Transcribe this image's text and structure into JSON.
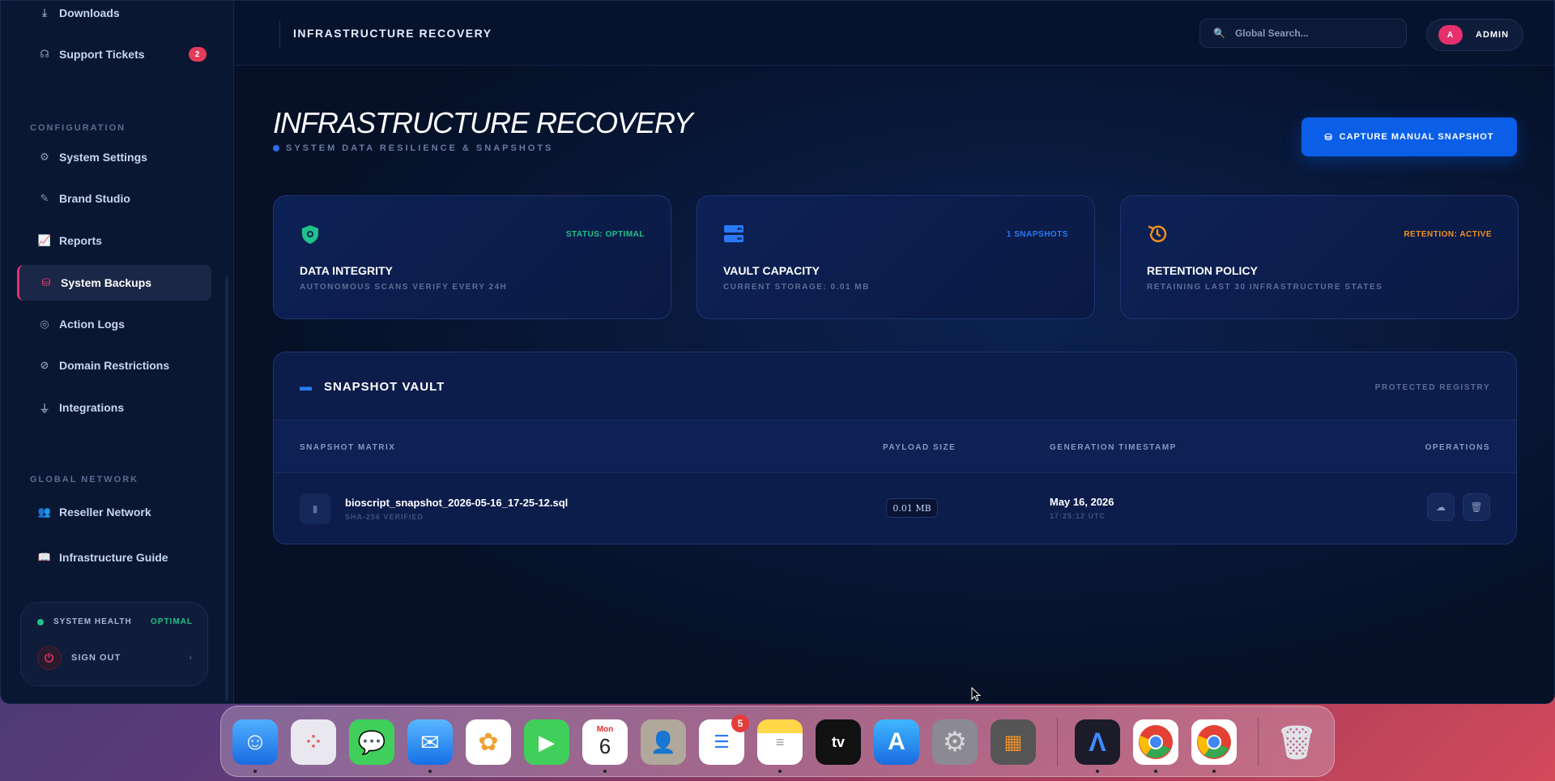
{
  "sidebar": {
    "items_top": [
      {
        "label": "Downloads",
        "icon": "download-icon"
      },
      {
        "label": "Support Tickets",
        "icon": "headset-icon",
        "badge": "2"
      }
    ],
    "config_label": "CONFIGURATION",
    "config_items": [
      {
        "label": "System Settings",
        "icon": "gear-icon"
      },
      {
        "label": "Brand Studio",
        "icon": "brush-icon"
      },
      {
        "label": "Reports",
        "icon": "chart-line-icon"
      },
      {
        "label": "System Backups",
        "icon": "database-icon",
        "active": true
      },
      {
        "label": "Action Logs",
        "icon": "fingerprint-icon"
      },
      {
        "label": "Domain Restrictions",
        "icon": "ban-icon"
      },
      {
        "label": "Integrations",
        "icon": "plug-icon"
      }
    ],
    "network_label": "GLOBAL NETWORK",
    "network_items": [
      {
        "label": "Reseller Network",
        "icon": "users-icon"
      },
      {
        "label": "Infrastructure Guide",
        "icon": "book-icon"
      }
    ],
    "health": {
      "label": "SYSTEM HEALTH",
      "status": "OPTIMAL"
    },
    "signout": "SIGN OUT"
  },
  "topbar": {
    "title": "INFRASTRUCTURE RECOVERY",
    "search_placeholder": "Global Search...",
    "user_initial": "A",
    "user_label": "ADMIN"
  },
  "page": {
    "title": "INFRASTRUCTURE RECOVERY",
    "subtitle": "SYSTEM DATA RESILIENCE & SNAPSHOTS",
    "capture_button": "CAPTURE MANUAL SNAPSHOT"
  },
  "cards": [
    {
      "tag": "STATUS: OPTIMAL",
      "title": "DATA INTEGRITY",
      "sub": "AUTONOMOUS SCANS VERIFY EVERY 24H",
      "color": "#1fc28a",
      "icon": "shield-virus-icon"
    },
    {
      "tag": "1 SNAPSHOTS",
      "title": "VAULT CAPACITY",
      "sub": "CURRENT STORAGE: 0.01 MB",
      "color": "#2a7af5",
      "icon": "server-icon"
    },
    {
      "tag": "RETENTION: ACTIVE",
      "title": "RETENTION POLICY",
      "sub": "RETAINING LAST 30 INFRASTRUCTURE STATES",
      "color": "#f0901e",
      "icon": "history-icon"
    }
  ],
  "vault": {
    "title": "SNAPSHOT VAULT",
    "registry": "PROTECTED REGISTRY",
    "columns": [
      "SNAPSHOT MATRIX",
      "PAYLOAD SIZE",
      "GENERATION TIMESTAMP",
      "OPERATIONS"
    ],
    "rows": [
      {
        "file": "bioscript_snapshot_2026-05-16_17-25-12.sql",
        "hash": "SHA-256 VERIFIED",
        "size": "0.01 MB",
        "date": "May 16, 2026",
        "time": "17:25:12 UTC"
      }
    ]
  },
  "dock": {
    "apps": [
      "Finder",
      "Launchpad",
      "Messages",
      "Mail",
      "Photos",
      "FaceTime",
      "Calendar",
      "Contacts",
      "Reminders",
      "Notes",
      "TV",
      "App Store",
      "System Settings",
      "Calculator",
      "Arc",
      "Chrome",
      "Chrome",
      "Trash"
    ],
    "calendar_month": "Mon",
    "calendar_day": "6",
    "reminders_badge": "5"
  },
  "colors": {
    "accent": "#0a5ee8",
    "active": "#e5306b",
    "success": "#1fc28a",
    "warning": "#f0901e"
  }
}
